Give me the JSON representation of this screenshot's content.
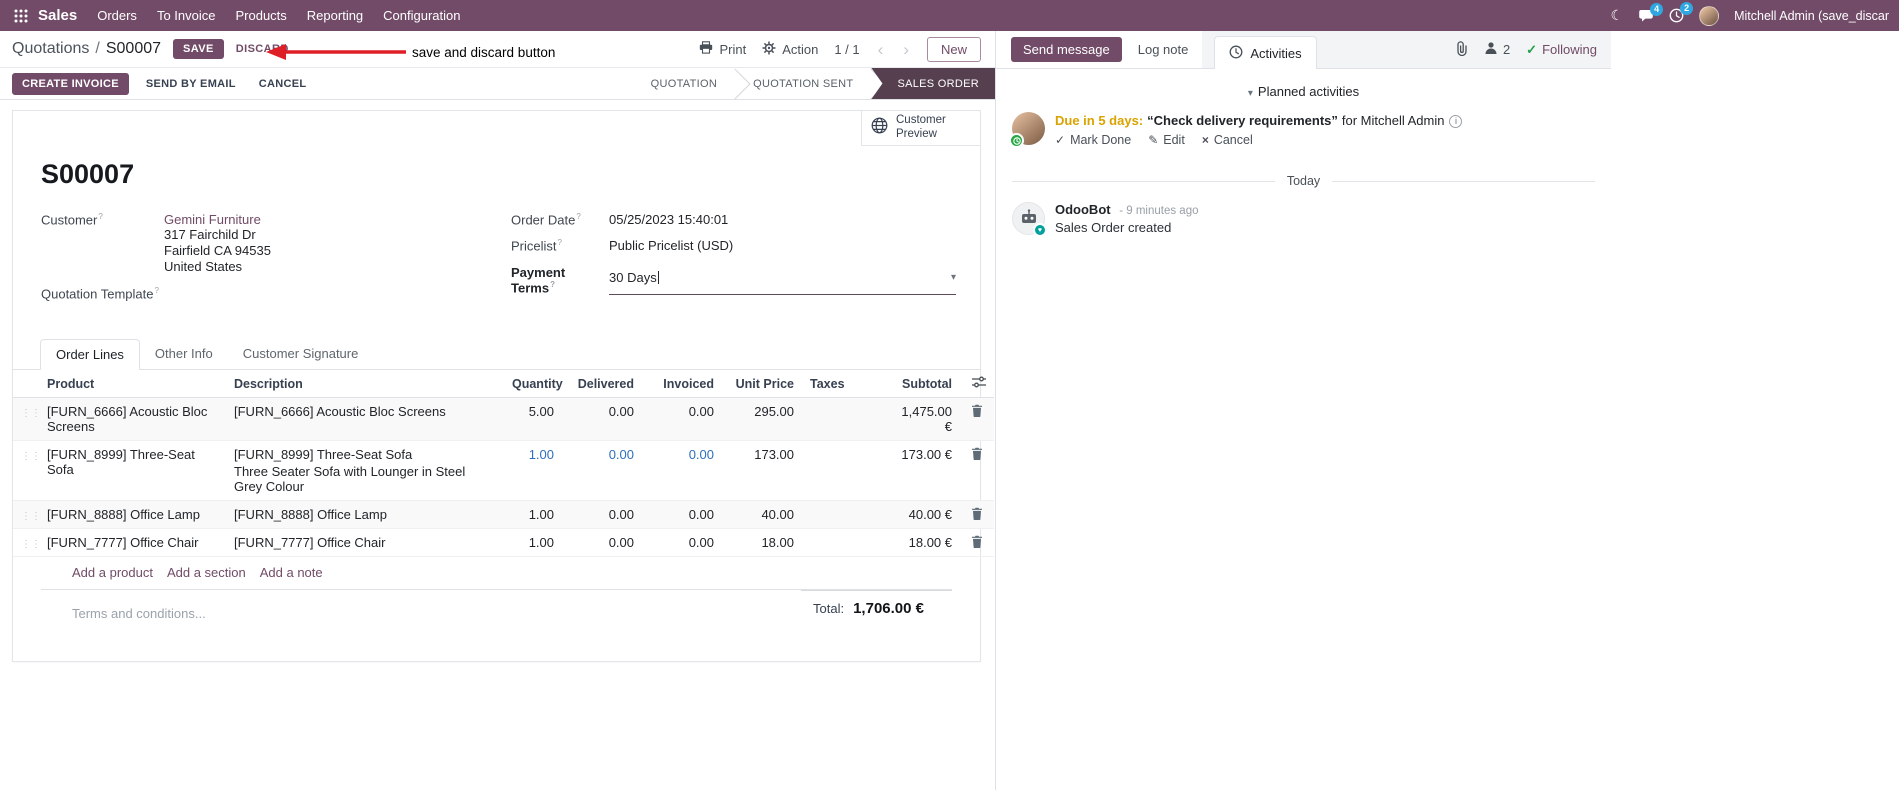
{
  "icons": {
    "moon": "☾",
    "caret_down": "▾",
    "chevron_left": "‹",
    "chevron_right": "›",
    "check": "✓",
    "pencil": "✎",
    "cross": "×",
    "info": "i",
    "drag": "⋮⋮",
    "heart": "♥"
  },
  "topbar": {
    "app_name": "Sales",
    "menus": [
      "Orders",
      "To Invoice",
      "Products",
      "Reporting",
      "Configuration"
    ],
    "messages_badge": "4",
    "activities_badge": "2",
    "user_name": "Mitchell Admin (save_discar"
  },
  "breadcrumb": {
    "parent": "Quotations",
    "separator": "/",
    "current": "S00007",
    "save": "SAVE",
    "discard": "DISCARD"
  },
  "annotation": {
    "text": "save and discard button"
  },
  "control_panel": {
    "print": "Print",
    "action": "Action",
    "pager": "1 / 1",
    "new": "New"
  },
  "status_buttons": {
    "create_invoice": "CREATE INVOICE",
    "send_by_email": "SEND BY EMAIL",
    "cancel": "CANCEL"
  },
  "statusbar": {
    "states": [
      {
        "label": "QUOTATION",
        "active": false
      },
      {
        "label": "QUOTATION SENT",
        "active": false
      },
      {
        "label": "SALES ORDER",
        "active": true
      }
    ]
  },
  "sheet": {
    "customer_preview": "Customer Preview",
    "title": "S00007",
    "help_marker": "?",
    "fields": {
      "customer_label": "Customer",
      "customer_name": "Gemini Furniture",
      "customer_address": [
        "317 Fairchild Dr",
        "Fairfield CA 94535",
        "United States"
      ],
      "quotation_template_label": "Quotation Template",
      "order_date_label": "Order Date",
      "order_date_value": "05/25/2023 15:40:01",
      "pricelist_label": "Pricelist",
      "pricelist_value": "Public Pricelist (USD)",
      "payment_terms_label": "Payment Terms",
      "payment_terms_value": "30 Days"
    },
    "tabs": [
      "Order Lines",
      "Other Info",
      "Customer Signature"
    ],
    "order_lines": {
      "columns": [
        "Product",
        "Description",
        "Quantity",
        "Delivered",
        "Invoiced",
        "Unit Price",
        "Taxes",
        "Subtotal"
      ],
      "rows": [
        {
          "product": "[FURN_6666] Acoustic Bloc Screens",
          "description": "[FURN_6666] Acoustic Bloc Screens",
          "description2": "",
          "quantity": "5.00",
          "delivered": "0.00",
          "invoiced": "0.00",
          "unit_price": "295.00",
          "taxes": "",
          "subtotal": "1,475.00 €"
        },
        {
          "product": "[FURN_8999] Three-Seat Sofa",
          "description": "[FURN_8999] Three-Seat Sofa",
          "description2": "Three Seater Sofa with Lounger in Steel Grey Colour",
          "quantity": "1.00",
          "delivered": "0.00",
          "invoiced": "0.00",
          "unit_price": "173.00",
          "taxes": "",
          "subtotal": "173.00 €"
        },
        {
          "product": "[FURN_8888] Office Lamp",
          "description": "[FURN_8888] Office Lamp",
          "description2": "",
          "quantity": "1.00",
          "delivered": "0.00",
          "invoiced": "0.00",
          "unit_price": "40.00",
          "taxes": "",
          "subtotal": "40.00 €"
        },
        {
          "product": "[FURN_7777] Office Chair",
          "description": "[FURN_7777] Office Chair",
          "description2": "",
          "quantity": "1.00",
          "delivered": "0.00",
          "invoiced": "0.00",
          "unit_price": "18.00",
          "taxes": "",
          "subtotal": "18.00 €"
        }
      ],
      "add_product": "Add a product",
      "add_section": "Add a section",
      "add_note": "Add a note"
    },
    "terms_placeholder": "Terms and conditions...",
    "total_label": "Total:",
    "total_value": "1,706.00 €"
  },
  "chatter": {
    "send_message": "Send message",
    "log_note": "Log note",
    "activities_tab": "Activities",
    "followers_count": "2",
    "following": "Following",
    "planned_header": "Planned activities",
    "activity": {
      "due": "Due in 5 days:",
      "summary": "“Check delivery requirements”",
      "assignee": "for Mitchell Admin",
      "mark_done": "Mark Done",
      "edit": "Edit",
      "cancel": "Cancel"
    },
    "date_divider": "Today",
    "message": {
      "author": "OdooBot",
      "timestamp": "- 9 minutes ago",
      "body": "Sales Order created"
    }
  }
}
